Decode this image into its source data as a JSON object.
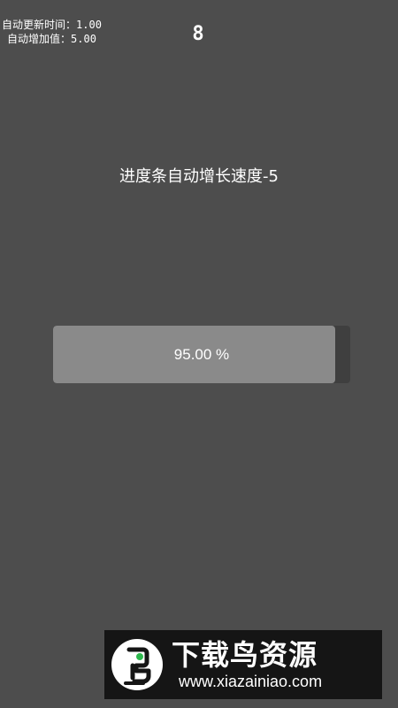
{
  "debug": {
    "update_interval_label": "自动更新时间：",
    "update_interval_value": "1.00",
    "increment_label": "自动增加值：",
    "increment_value": "5.00"
  },
  "counter": "8",
  "speed_label": "进度条自动增长速度-5",
  "progress": {
    "value": 95.0,
    "text": "95.00 %",
    "fill_color": "#8a8a8a",
    "track_color": "#3f3f3f"
  },
  "watermark": {
    "title": "下载鸟资源",
    "url": "www.xiazainiao.com",
    "icon": "bird-logo-icon"
  }
}
